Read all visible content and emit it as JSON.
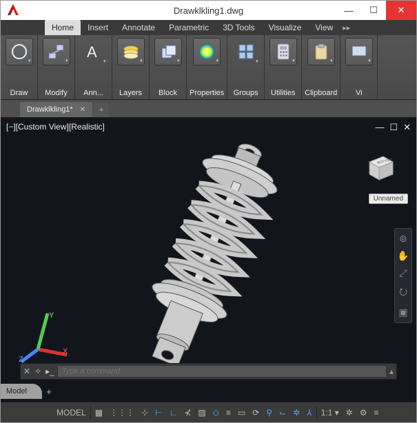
{
  "titlebar": {
    "title": "Drawklkling1.dwg",
    "min": "—",
    "max": "☐",
    "close": "✕"
  },
  "menu": {
    "tabs": [
      "Home",
      "Insert",
      "Annotate",
      "Parametric",
      "3D Tools",
      "Visualize",
      "View"
    ],
    "active": "Home",
    "overflow": "▸▸"
  },
  "ribbon": {
    "panels": [
      {
        "label": "Draw",
        "icon": "circle"
      },
      {
        "label": "Modify",
        "icon": "modify"
      },
      {
        "label": "Ann...",
        "icon": "text"
      },
      {
        "label": "Layers",
        "icon": "layers"
      },
      {
        "label": "Block",
        "icon": "block"
      },
      {
        "label": "Properties",
        "icon": "properties"
      },
      {
        "label": "Groups",
        "icon": "groups"
      },
      {
        "label": "Utilities",
        "icon": "utilities"
      },
      {
        "label": "Clipboard",
        "icon": "clipboard"
      },
      {
        "label": "Vi",
        "icon": "view"
      }
    ]
  },
  "file_tabs": {
    "items": [
      {
        "label": "Drawklkling1*",
        "closable": true
      }
    ],
    "add": "+"
  },
  "viewport": {
    "info": "[−][Custom View][Realistic]",
    "controls": {
      "min": "—",
      "max": "☐",
      "close": "✕"
    },
    "viewcube_face": "BOTTOM",
    "unnamed": "Unnamed",
    "ucs": {
      "x": "X",
      "y": "Y",
      "z": "Z"
    }
  },
  "command": {
    "placeholder": "Type a command",
    "prompt": "▸_"
  },
  "layout": {
    "active": "Model",
    "add": "+"
  },
  "status": {
    "mode": "MODEL",
    "scale": "1:1",
    "items": [
      {
        "name": "grid",
        "glyph": "▦",
        "active": false
      },
      {
        "name": "snap",
        "glyph": "⋮⋮⋮",
        "active": false
      },
      {
        "name": "infer",
        "glyph": "⊹",
        "active": false
      },
      {
        "name": "dyn",
        "glyph": "⊢",
        "active": true
      },
      {
        "name": "ortho",
        "glyph": "∟",
        "active": true
      },
      {
        "name": "polar",
        "glyph": "⊀",
        "active": false
      },
      {
        "name": "iso",
        "glyph": "▨",
        "active": false
      },
      {
        "name": "osnap",
        "glyph": "◇",
        "active": true
      },
      {
        "name": "lwt",
        "glyph": "≡",
        "active": false
      },
      {
        "name": "trn",
        "glyph": "▭",
        "active": false
      },
      {
        "name": "cyc",
        "glyph": "⟳",
        "active": false
      },
      {
        "name": "3dosnap",
        "glyph": "⚲",
        "active": true
      },
      {
        "name": "ducs",
        "glyph": "⌙",
        "active": true
      },
      {
        "name": "filter",
        "glyph": "✲",
        "active": true
      },
      {
        "name": "gizmo",
        "glyph": "⅄",
        "active": true
      }
    ],
    "tail": [
      {
        "name": "anno",
        "glyph": "✲"
      },
      {
        "name": "gear",
        "glyph": "⚙"
      },
      {
        "name": "menu",
        "glyph": "≡"
      }
    ]
  }
}
